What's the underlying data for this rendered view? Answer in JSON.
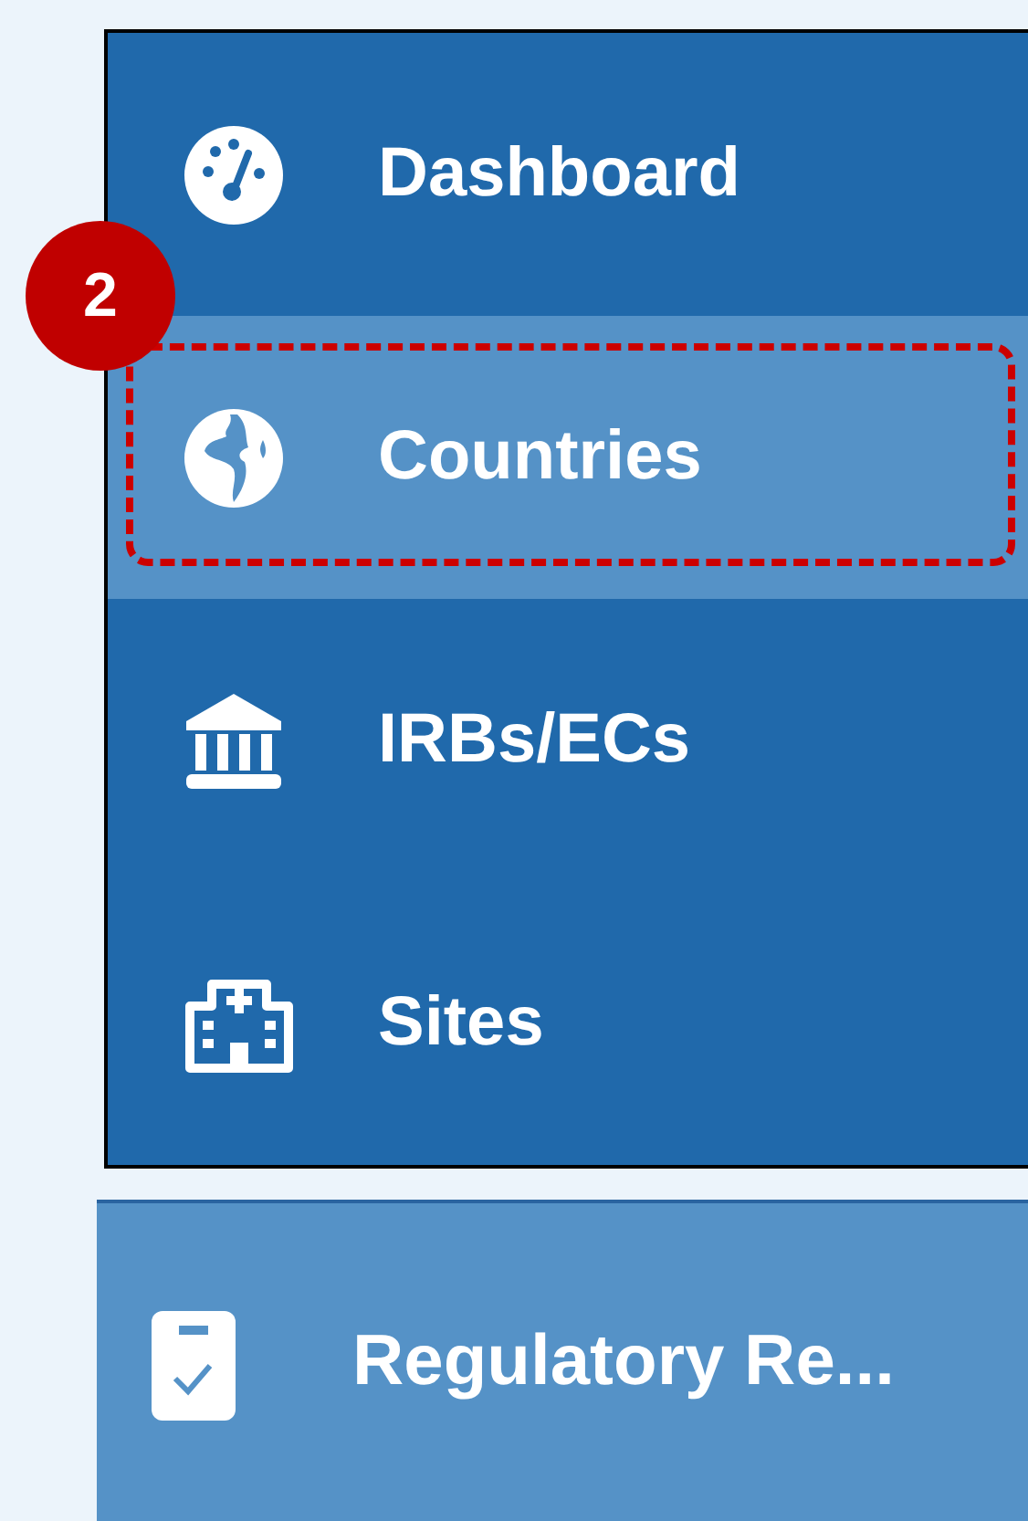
{
  "nav_items": [
    {
      "label": "Dashboard",
      "selected": false
    },
    {
      "label": "Countries",
      "selected": true,
      "annotation": {
        "number": "2"
      }
    },
    {
      "label": "IRBs/ECs",
      "selected": false
    },
    {
      "label": "Sites",
      "selected": false
    }
  ],
  "section": {
    "label": "Regulatory Re..."
  }
}
